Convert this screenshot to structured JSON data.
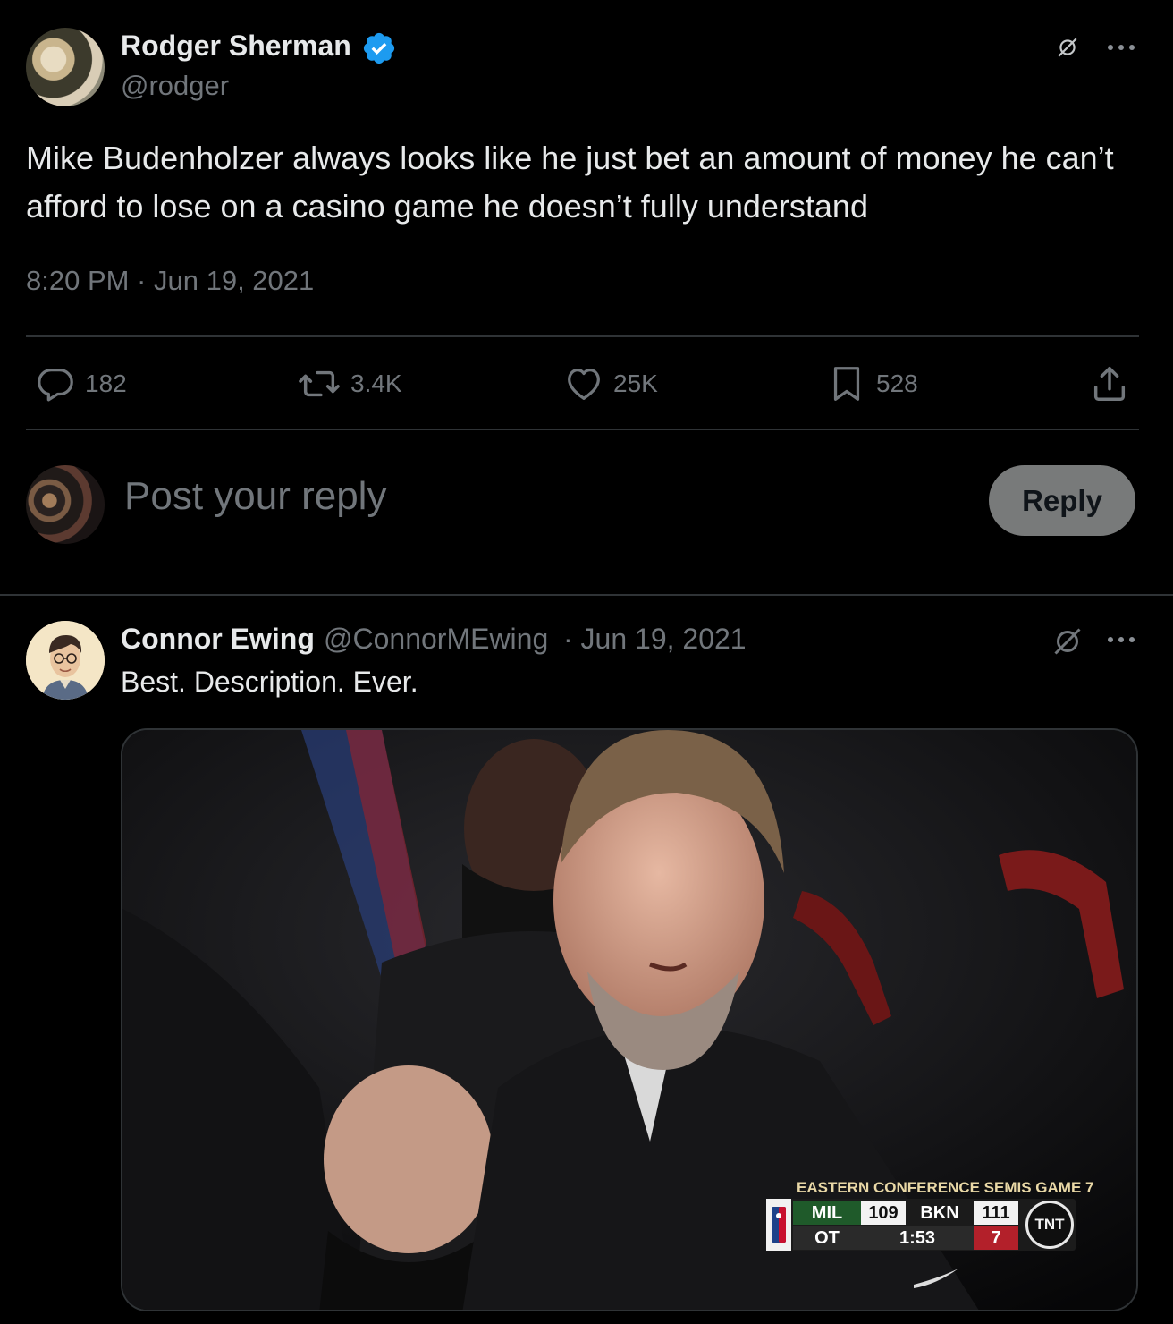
{
  "tweet": {
    "author_name": "Rodger Sherman",
    "author_handle": "@rodger",
    "text": "Mike Budenholzer always looks like he just bet an amount of money he can’t afford to lose on a casino game he doesn’t fully understand",
    "timestamp": "8:20 PM · Jun 19, 2021",
    "stats": {
      "replies": "182",
      "retweets": "3.4K",
      "likes": "25K",
      "bookmarks": "528"
    }
  },
  "composer": {
    "placeholder": "Post your reply",
    "reply_label": "Reply"
  },
  "reply": {
    "author_name": "Connor Ewing",
    "author_handle": "@ConnorMEwing",
    "date": "· Jun 19, 2021",
    "text": "Best. Description. Ever.",
    "scorebug": {
      "title": "EASTERN CONFERENCE SEMIS GAME 7",
      "team1": "MIL",
      "score1": "109",
      "team2": "BKN",
      "score2": "111",
      "period": "OT",
      "clock": "1:53",
      "shot_clock": "7",
      "network": "TNT"
    }
  },
  "colors": {
    "background": "#000000",
    "text": "#e7e9ea",
    "muted": "#71767b",
    "divider": "#2f3336",
    "verified": "#1d9bf0"
  }
}
